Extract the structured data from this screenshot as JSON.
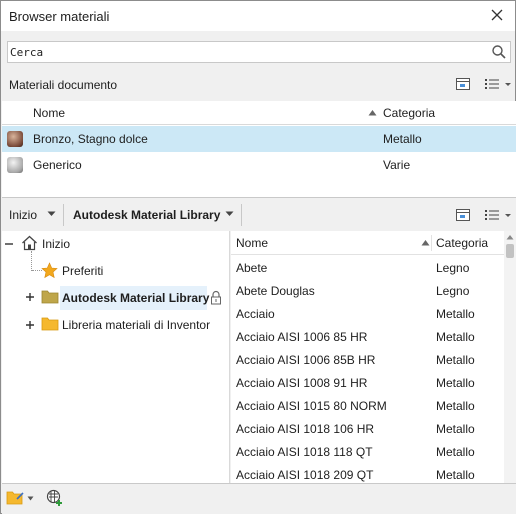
{
  "window": {
    "title": "Browser materiali"
  },
  "search": {
    "placeholder": "Cerca"
  },
  "document_section": {
    "label": "Materiali documento",
    "columns": {
      "name": "Nome",
      "category": "Categoria"
    },
    "rows": [
      {
        "name": "Bronzo, Stagno dolce",
        "category": "Metallo"
      },
      {
        "name": "Generico",
        "category": "Varie"
      }
    ]
  },
  "library_bar": {
    "home_label": "Inizio",
    "library_label": "Autodesk Material Library"
  },
  "tree": {
    "root": "Inizio",
    "items": [
      "Preferiti",
      "Autodesk Material Library",
      "Libreria materiali di Inventor"
    ]
  },
  "library_list": {
    "columns": {
      "name": "Nome",
      "category": "Categoria"
    },
    "rows": [
      {
        "name": "Abete",
        "category": "Legno"
      },
      {
        "name": "Abete Douglas",
        "category": "Legno"
      },
      {
        "name": "Acciaio",
        "category": "Metallo"
      },
      {
        "name": "Acciaio AISI 1006 85 HR",
        "category": "Metallo"
      },
      {
        "name": "Acciaio AISI 1006 85B HR",
        "category": "Metallo"
      },
      {
        "name": "Acciaio AISI 1008 91 HR",
        "category": "Metallo"
      },
      {
        "name": "Acciaio AISI 1015 80 NORM",
        "category": "Metallo"
      },
      {
        "name": "Acciaio AISI 1018 106 HR",
        "category": "Metallo"
      },
      {
        "name": "Acciaio AISI 1018 118 QT",
        "category": "Metallo"
      },
      {
        "name": "Acciaio AISI 1018 209 QT",
        "category": "Metallo"
      }
    ]
  },
  "colors": {
    "selected_row": "#cce8f6",
    "folder": "#e8b33a",
    "star": "#f2a81d"
  }
}
